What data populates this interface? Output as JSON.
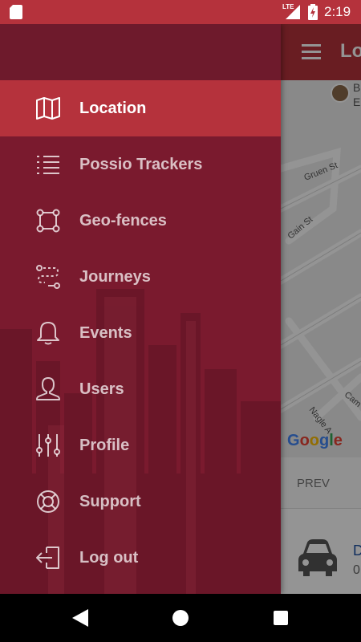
{
  "status_bar": {
    "network": "LTE",
    "time": "2:19"
  },
  "app": {
    "title": "Lo",
    "map": {
      "streets": [
        "Gruen St",
        "Gain St",
        "Cam",
        "Nagle A"
      ],
      "poi_label": "B\nE",
      "google_logo": [
        "G",
        "o",
        "o",
        "g",
        "l",
        "e"
      ],
      "google_colors": [
        "#4285F4",
        "#EA4335",
        "#FBBC05",
        "#4285F4",
        "#34A853",
        "#EA4335"
      ]
    },
    "pager": {
      "prev_label": "PREV"
    },
    "vehicle": {
      "name": "D",
      "sub": "0"
    }
  },
  "drawer": {
    "accent_color": "#b5323c",
    "items": [
      {
        "label": "Location",
        "icon": "map-icon",
        "active": true
      },
      {
        "label": "Possio Trackers",
        "icon": "list-icon",
        "active": false
      },
      {
        "label": "Geo-fences",
        "icon": "geofence-icon",
        "active": false
      },
      {
        "label": "Journeys",
        "icon": "route-icon",
        "active": false
      },
      {
        "label": "Events",
        "icon": "bell-icon",
        "active": false
      },
      {
        "label": "Users",
        "icon": "user-icon",
        "active": false
      },
      {
        "label": "Profile",
        "icon": "sliders-icon",
        "active": false
      },
      {
        "label": "Support",
        "icon": "lifebuoy-icon",
        "active": false
      },
      {
        "label": "Log out",
        "icon": "logout-icon",
        "active": false
      }
    ]
  }
}
